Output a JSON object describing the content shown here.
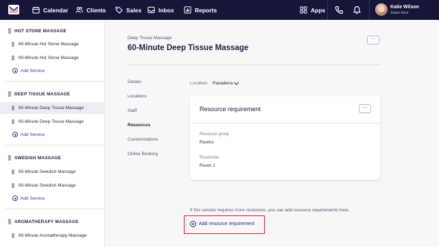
{
  "nav": {
    "items": [
      {
        "label": "Calendar",
        "icon": "calendar-icon"
      },
      {
        "label": "Clients",
        "icon": "users-icon"
      },
      {
        "label": "Sales",
        "icon": "tag-icon"
      },
      {
        "label": "Inbox",
        "icon": "inbox-icon"
      },
      {
        "label": "Reports",
        "icon": "bar-chart-icon"
      }
    ],
    "apps_label": "Apps",
    "user": {
      "name": "Katie Wilson",
      "location": "Salon Azul"
    },
    "colors": {
      "nav_bg": "#16163a",
      "accent": "#3a3a8c",
      "highlight": "#d42020"
    }
  },
  "sidebar": {
    "groups": [
      {
        "title": "HOT STONE MASSAGE",
        "services": [
          "60-Minute Hot Stone Massage",
          "90-Minute Hot Stone Massage"
        ],
        "add_label": "Add Service"
      },
      {
        "title": "DEEP TISSUE MASSAGE",
        "services": [
          "60-Minute Deep Tissue Massage",
          "90-Minute Deep Tissue Massage"
        ],
        "add_label": "Add Service"
      },
      {
        "title": "SWEDISH MASSAGE",
        "services": [
          "60-Minute Swedish Massage",
          "90-Minute Swedish Massage"
        ],
        "add_label": "Add Service"
      },
      {
        "title": "AROMATHERAPY MASSAGE",
        "services": [
          "60-Minute Aromatherapy Massage"
        ]
      }
    ]
  },
  "main": {
    "breadcrumb": "Deep Tissue Massage",
    "title": "60-Minute Deep Tissue Massage",
    "more_label": "···",
    "tabs": [
      "Details",
      "Locations",
      "Staff",
      "Resources",
      "Customizations",
      "Online Booking"
    ],
    "active_tab": "Resources",
    "location_label": "Location:",
    "location_value": "Pasadena",
    "card": {
      "title": "Resource requirement",
      "group_label": "Resource group",
      "group_value": "Rooms",
      "resources_label": "Resources",
      "resources_value": "Room 2"
    },
    "hint": "If this service requires more resources, you can add resource requirements here.",
    "add_requirement_label": "Add resource requirement"
  }
}
